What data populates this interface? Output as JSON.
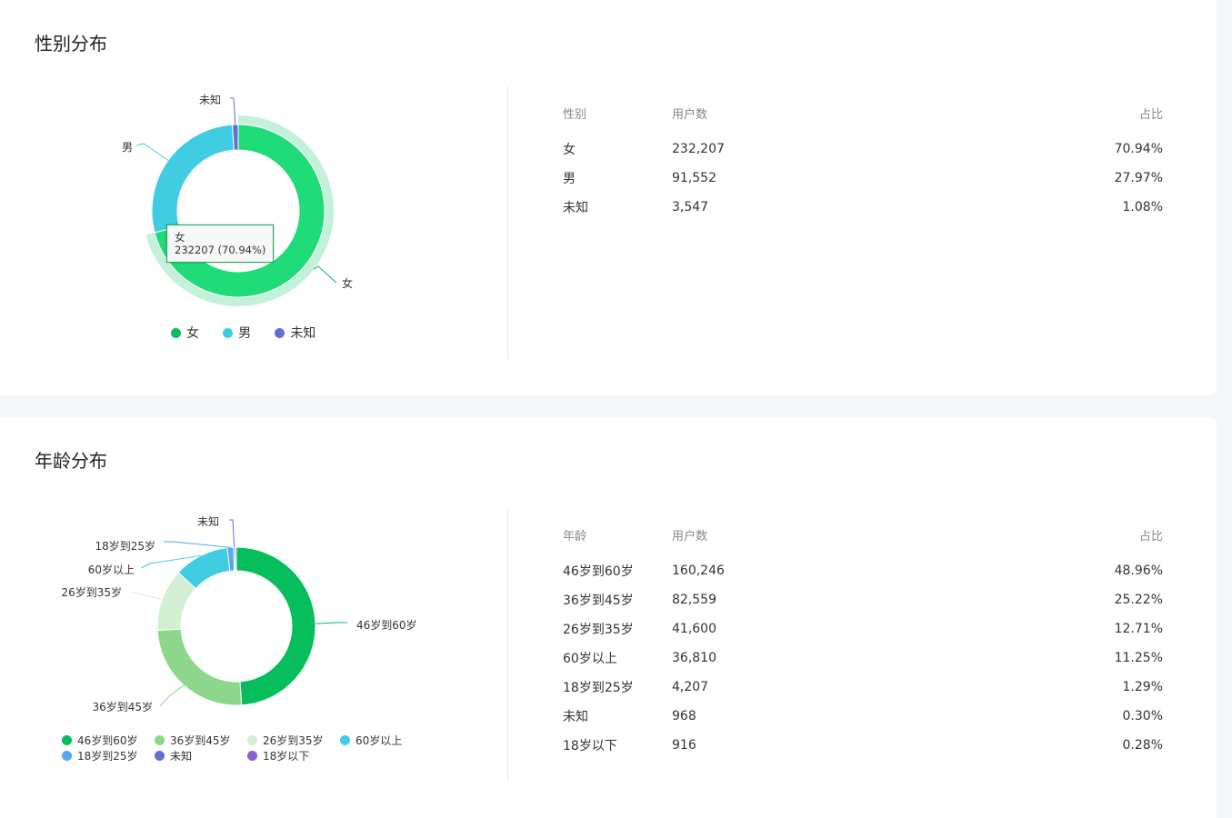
{
  "colors": {
    "green": "#06bf5c",
    "green_hover": "#1fdb78",
    "green_halo": "#c4f1da",
    "cyan": "#40cde2",
    "indigo": "#6270cf",
    "light_green": "#8dd78c",
    "pale_green": "#d3efd3",
    "blue": "#56a7f5",
    "purple": "#8c5ed0"
  },
  "gender": {
    "title": "性别分布",
    "headers": [
      "性别",
      "用户数",
      "占比"
    ],
    "rows": [
      {
        "label": "女",
        "count": "232,207",
        "pct": "70.94%"
      },
      {
        "label": "男",
        "count": "91,552",
        "pct": "27.97%"
      },
      {
        "label": "未知",
        "count": "3,547",
        "pct": "1.08%"
      }
    ],
    "legend": [
      "女",
      "男",
      "未知"
    ],
    "tooltip": {
      "name": "女",
      "value": "232207 (70.94%)"
    }
  },
  "age": {
    "title": "年龄分布",
    "headers": [
      "年龄",
      "用户数",
      "占比"
    ],
    "rows": [
      {
        "label": "46岁到60岁",
        "count": "160,246",
        "pct": "48.96%"
      },
      {
        "label": "36岁到45岁",
        "count": "82,559",
        "pct": "25.22%"
      },
      {
        "label": "26岁到35岁",
        "count": "41,600",
        "pct": "12.71%"
      },
      {
        "label": "60岁以上",
        "count": "36,810",
        "pct": "11.25%"
      },
      {
        "label": "18岁到25岁",
        "count": "4,207",
        "pct": "1.29%"
      },
      {
        "label": "未知",
        "count": "968",
        "pct": "0.30%"
      },
      {
        "label": "18岁以下",
        "count": "916",
        "pct": "0.28%"
      }
    ],
    "legend": [
      "46岁到60岁",
      "36岁到45岁",
      "26岁到35岁",
      "60岁以上",
      "18岁到25岁",
      "未知",
      "18岁以下"
    ]
  },
  "chart_data": [
    {
      "type": "pie",
      "title": "性别分布",
      "categories": [
        "女",
        "男",
        "未知"
      ],
      "values": [
        232207,
        91552,
        3547
      ],
      "percentages": [
        70.94,
        27.97,
        1.08
      ],
      "colors": [
        "#06bf5c",
        "#40cde2",
        "#6270cf"
      ],
      "donut": true,
      "highlighted": "女",
      "legend": "bottom"
    },
    {
      "type": "pie",
      "title": "年龄分布",
      "categories": [
        "46岁到60岁",
        "36岁到45岁",
        "26岁到35岁",
        "60岁以上",
        "18岁到25岁",
        "未知",
        "18岁以下"
      ],
      "values": [
        160246,
        82559,
        41600,
        36810,
        4207,
        968,
        916
      ],
      "percentages": [
        48.96,
        25.22,
        12.71,
        11.25,
        1.29,
        0.3,
        0.28
      ],
      "colors": [
        "#06bf5c",
        "#8dd78c",
        "#d3efd3",
        "#40cde2",
        "#56a7f5",
        "#6270cf",
        "#8c5ed0"
      ],
      "donut": true,
      "slice_labels_shown": [
        "46岁到60岁",
        "36岁到45岁",
        "26岁到35岁",
        "60岁以上",
        "18岁到25岁",
        "未知"
      ],
      "legend": "bottom"
    }
  ]
}
